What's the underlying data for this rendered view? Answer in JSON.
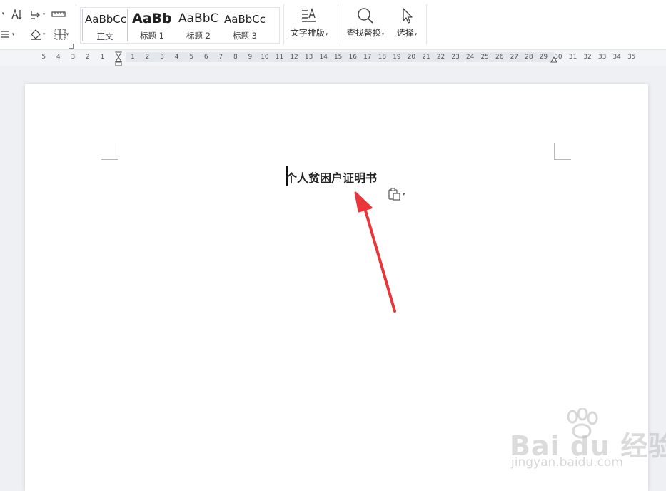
{
  "ribbon": {
    "styles": [
      {
        "preview": "AaBbCcI",
        "label": "正文"
      },
      {
        "preview": "AaBb",
        "label": "标题 1"
      },
      {
        "preview": "AaBbC",
        "label": "标题 2"
      },
      {
        "preview": "AaBbCc",
        "label": "标题 3"
      }
    ],
    "text_layout_label": "文字排版",
    "find_replace_label": "查找替换",
    "select_label": "选择"
  },
  "ruler": {
    "left_numbers": [
      "5",
      "4",
      "3",
      "2",
      "1"
    ],
    "right_numbers": [
      "1",
      "2",
      "3",
      "4",
      "5",
      "6",
      "7",
      "8",
      "9",
      "10",
      "11",
      "12",
      "13",
      "14",
      "15",
      "16",
      "17",
      "18",
      "19",
      "20",
      "21",
      "22",
      "23",
      "24",
      "25",
      "26",
      "27",
      "28",
      "29",
      "30",
      "31",
      "32",
      "33",
      "34",
      "35"
    ]
  },
  "document": {
    "title": "个人贫困户证明书"
  },
  "watermark": {
    "brand": "Bai du 经验",
    "url": "jingyan.baidu.com"
  },
  "colors": {
    "arrow": "#e8363a",
    "ribbon_bg": "#ffffff",
    "workspace_bg": "#eef0f3"
  }
}
